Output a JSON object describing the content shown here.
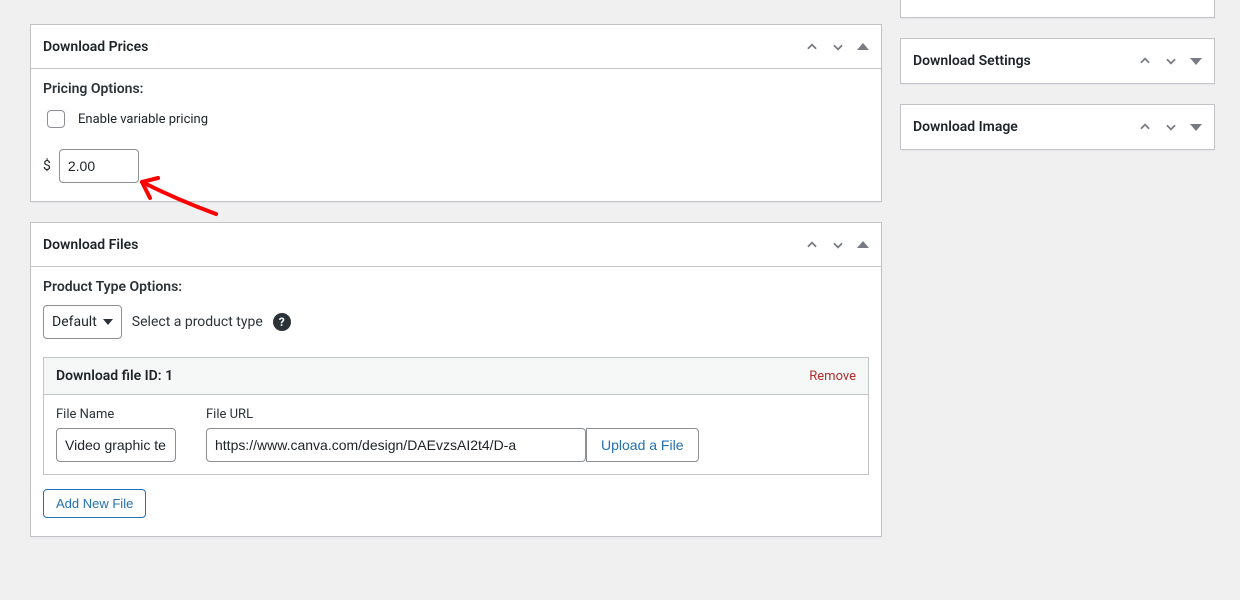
{
  "prices_box": {
    "title": "Download Prices",
    "label": "Pricing Options:",
    "variable_label": "Enable variable pricing",
    "currency": "$",
    "price_value": "2.00"
  },
  "files_box": {
    "title": "Download Files",
    "label": "Product Type Options:",
    "product_type_selected": "Default",
    "product_type_hint": "Select a product type",
    "file_id_label": "Download file ID: 1",
    "remove_label": "Remove",
    "file_name_label": "File Name",
    "file_name_value": "Video graphic te",
    "file_url_label": "File URL",
    "file_url_value": "https://www.canva.com/design/DAEvzsAI2t4/D-a",
    "upload_label": "Upload a File",
    "add_new_label": "Add New File"
  },
  "sidebar": {
    "settings_title": "Download Settings",
    "image_title": "Download Image"
  }
}
